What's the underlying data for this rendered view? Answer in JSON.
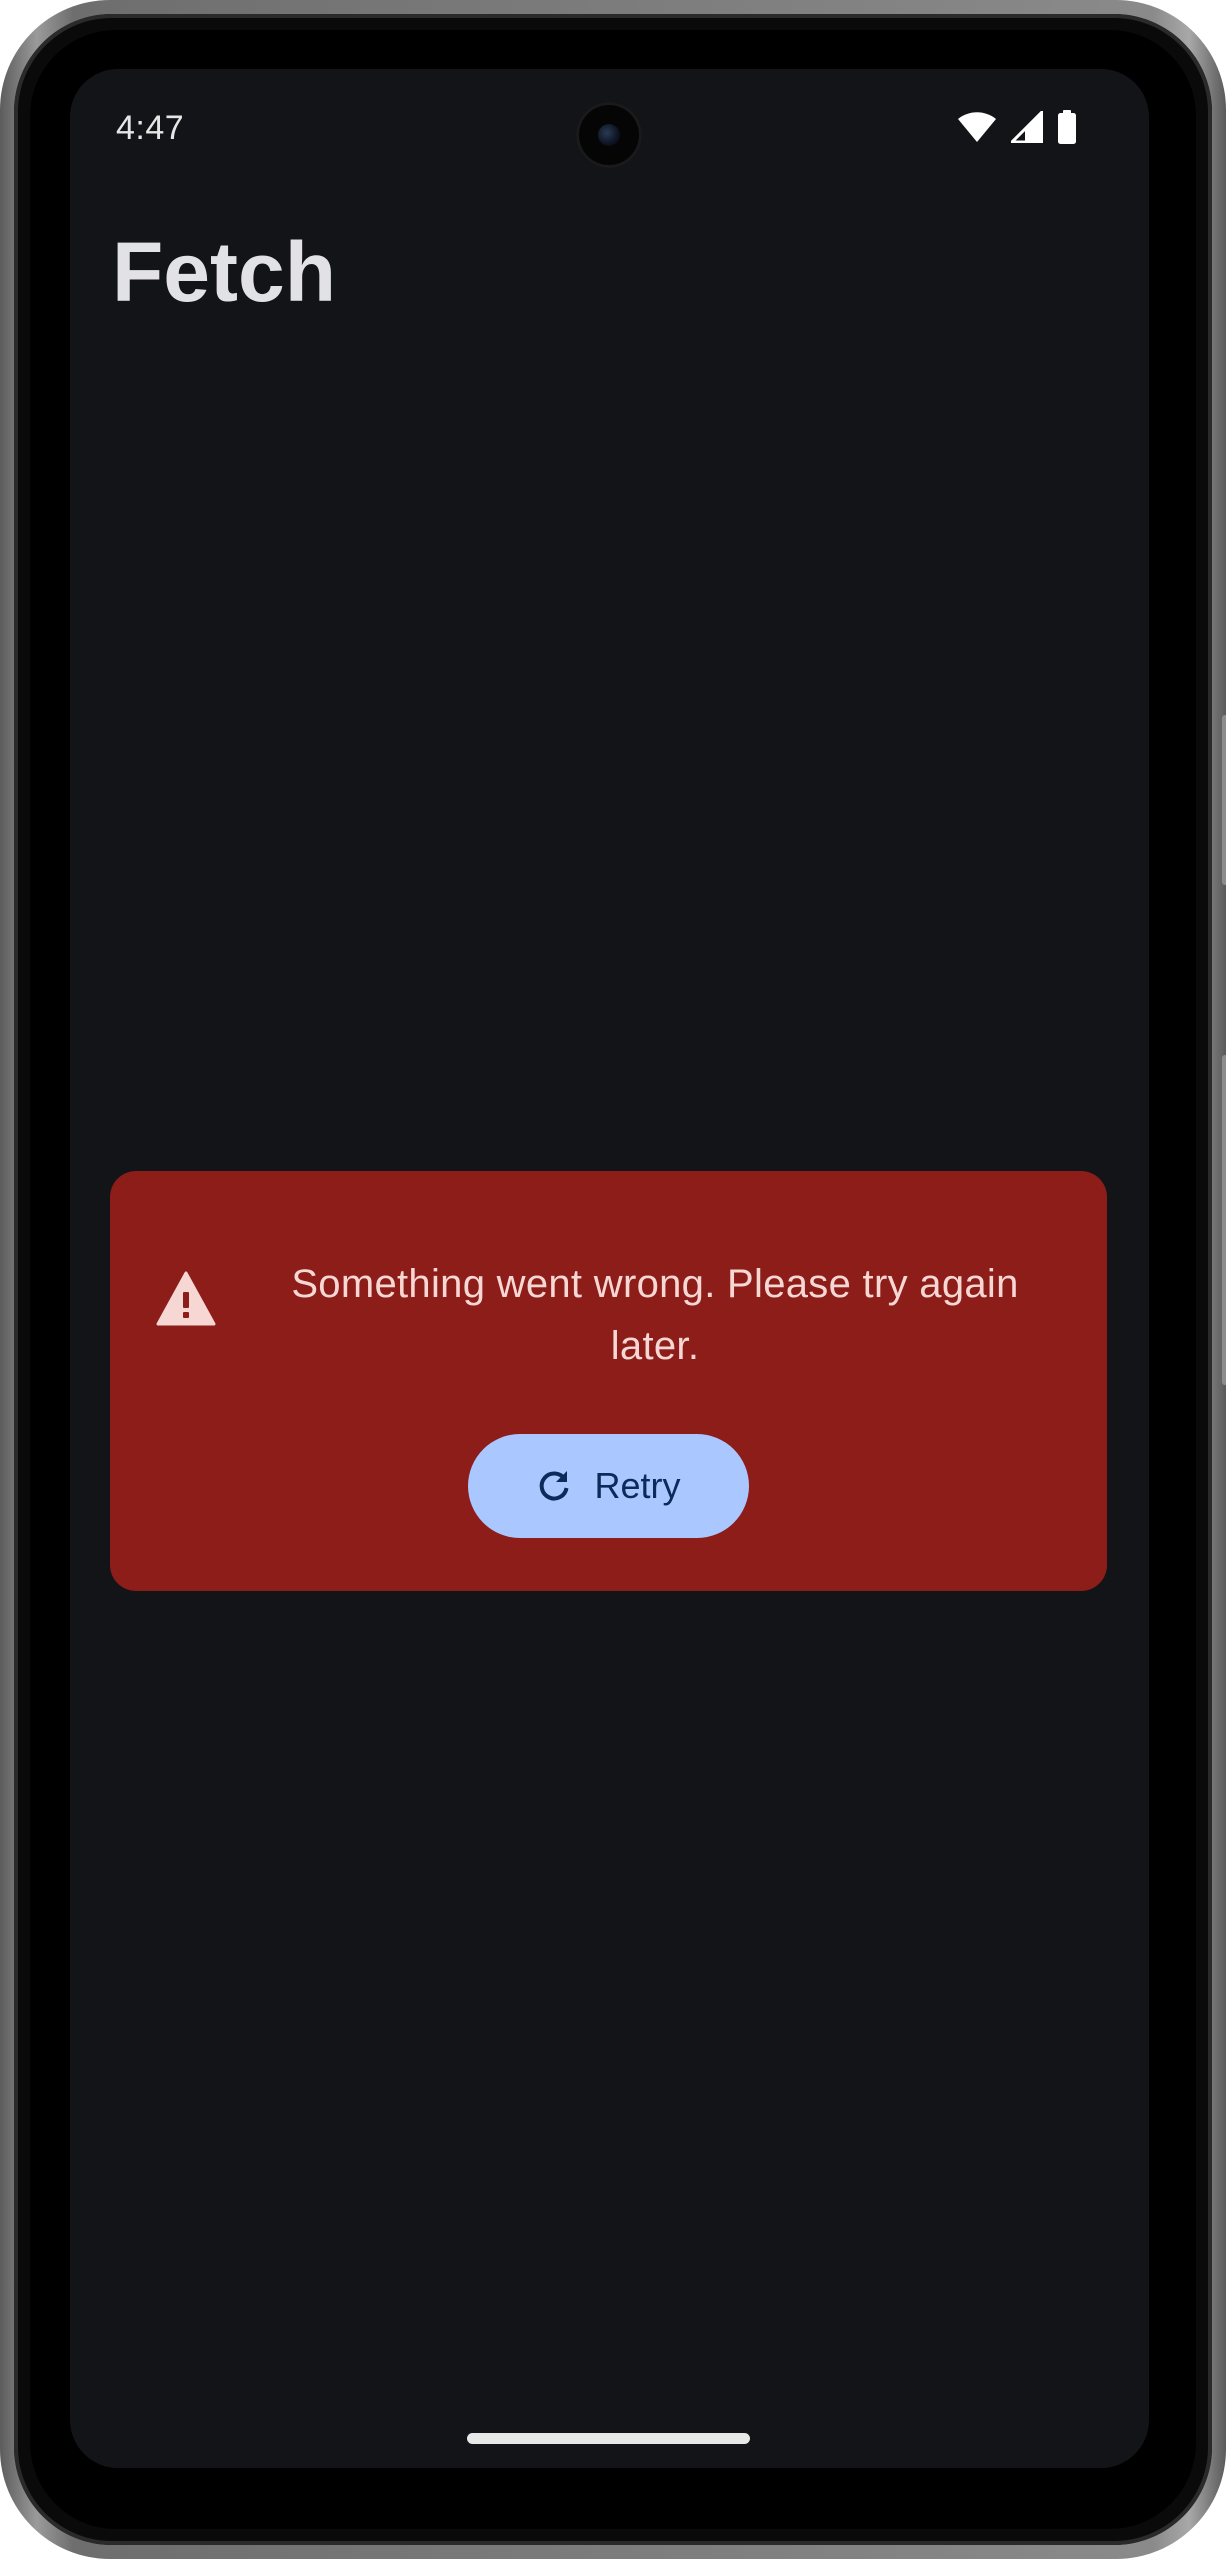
{
  "status_bar": {
    "time": "4:47",
    "icons": [
      "wifi-icon",
      "cellular-signal-icon",
      "battery-icon"
    ]
  },
  "app": {
    "title": "Fetch"
  },
  "error_card": {
    "icon": "warning-icon",
    "message": "Something went wrong. Please try again later.",
    "retry_button": {
      "icon": "refresh-icon",
      "label": "Retry"
    }
  },
  "colors": {
    "background": "#131417",
    "title_text": "#e2e2e6",
    "error_container": "#8c1d19",
    "on_error_container": "#f6d7d4",
    "retry_button_bg": "#aac7ff",
    "retry_button_text": "#0c2a5a"
  }
}
